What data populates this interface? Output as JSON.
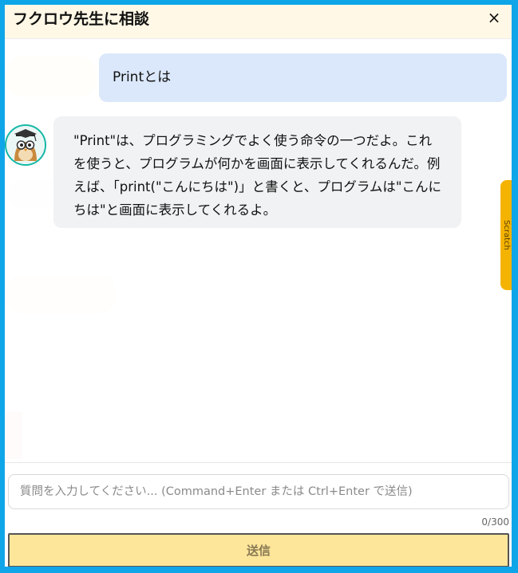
{
  "header": {
    "title": "フクロウ先生に相談",
    "close_label": "×"
  },
  "messages": [
    {
      "role": "user",
      "text": "Printとは"
    },
    {
      "role": "assistant",
      "text": "\"Print\"は、プログラミングでよく使う命令の一つだよ。これを使うと、プログラムが何かを画面に表示してくれるんだ。例えば、「print(\"こんにちは\")」と書くと、プログラムは\"こんにちは\"と画面に表示してくれるよ。"
    }
  ],
  "side_tab": {
    "label": "Scratch"
  },
  "composer": {
    "placeholder": "質問を入力してください... (Command+Enter または Ctrl+Enter で送信)",
    "value": "",
    "counter": "0/300",
    "send_label": "送信"
  },
  "colors": {
    "frame": "#0ea5e9",
    "header_bg": "#fff8e6",
    "user_bubble": "#dbe8fb",
    "assistant_bubble": "#f1f2f4",
    "send_button": "#fde69a",
    "avatar_ring": "#14b8a6",
    "side_tab": "#f5b301"
  },
  "icons": {
    "avatar": "owl-teacher-avatar-icon",
    "close": "close-icon"
  }
}
